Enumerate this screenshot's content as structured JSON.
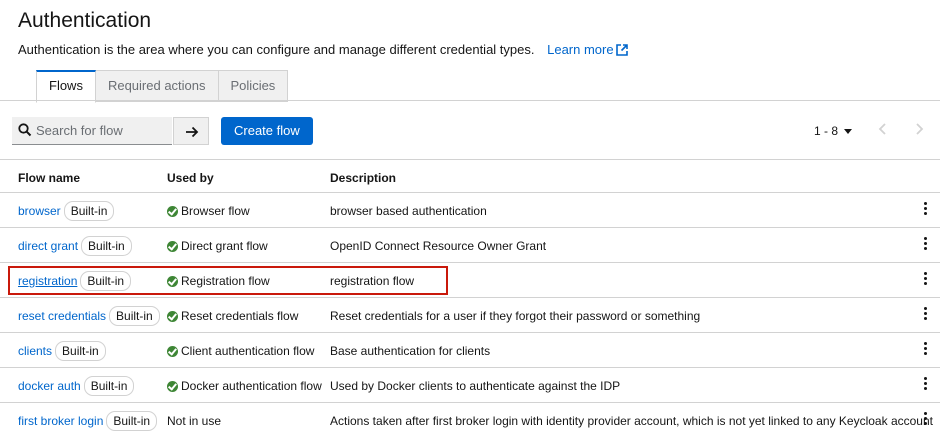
{
  "header": {
    "title": "Authentication",
    "description": "Authentication is the area where you can configure and manage different credential types.",
    "learn_more": "Learn more"
  },
  "tabs": [
    {
      "label": "Flows",
      "active": true
    },
    {
      "label": "Required actions",
      "active": false
    },
    {
      "label": "Policies",
      "active": false
    }
  ],
  "toolbar": {
    "search_placeholder": "Search for flow",
    "create_label": "Create flow",
    "pagination": "1 - 8"
  },
  "table": {
    "columns": [
      "Flow name",
      "Used by",
      "Description"
    ],
    "rows": [
      {
        "name": "browser",
        "badge": "Built-in",
        "used_by": "Browser flow",
        "used": true,
        "description": "browser based authentication"
      },
      {
        "name": "direct grant",
        "badge": "Built-in",
        "used_by": "Direct grant flow",
        "used": true,
        "description": "OpenID Connect Resource Owner Grant"
      },
      {
        "name": "registration",
        "badge": "Built-in",
        "used_by": "Registration flow",
        "used": true,
        "description": "registration flow"
      },
      {
        "name": "reset credentials",
        "badge": "Built-in",
        "used_by": "Reset credentials flow",
        "used": true,
        "description": "Reset credentials for a user if they forgot their password or something"
      },
      {
        "name": "clients",
        "badge": "Built-in",
        "used_by": "Client authentication flow",
        "used": true,
        "description": "Base authentication for clients"
      },
      {
        "name": "docker auth",
        "badge": "Built-in",
        "used_by": "Docker authentication flow",
        "used": true,
        "description": "Used by Docker clients to authenticate against the IDP"
      },
      {
        "name": "first broker login",
        "badge": "Built-in",
        "used_by": "Not in use",
        "used": false,
        "description": "Actions taken after first broker login with identity provider account, which is not yet linked to any Keycloak account"
      }
    ]
  },
  "colors": {
    "accent": "#0066cc",
    "success": "#3e8635",
    "highlight": "#c9190b"
  }
}
